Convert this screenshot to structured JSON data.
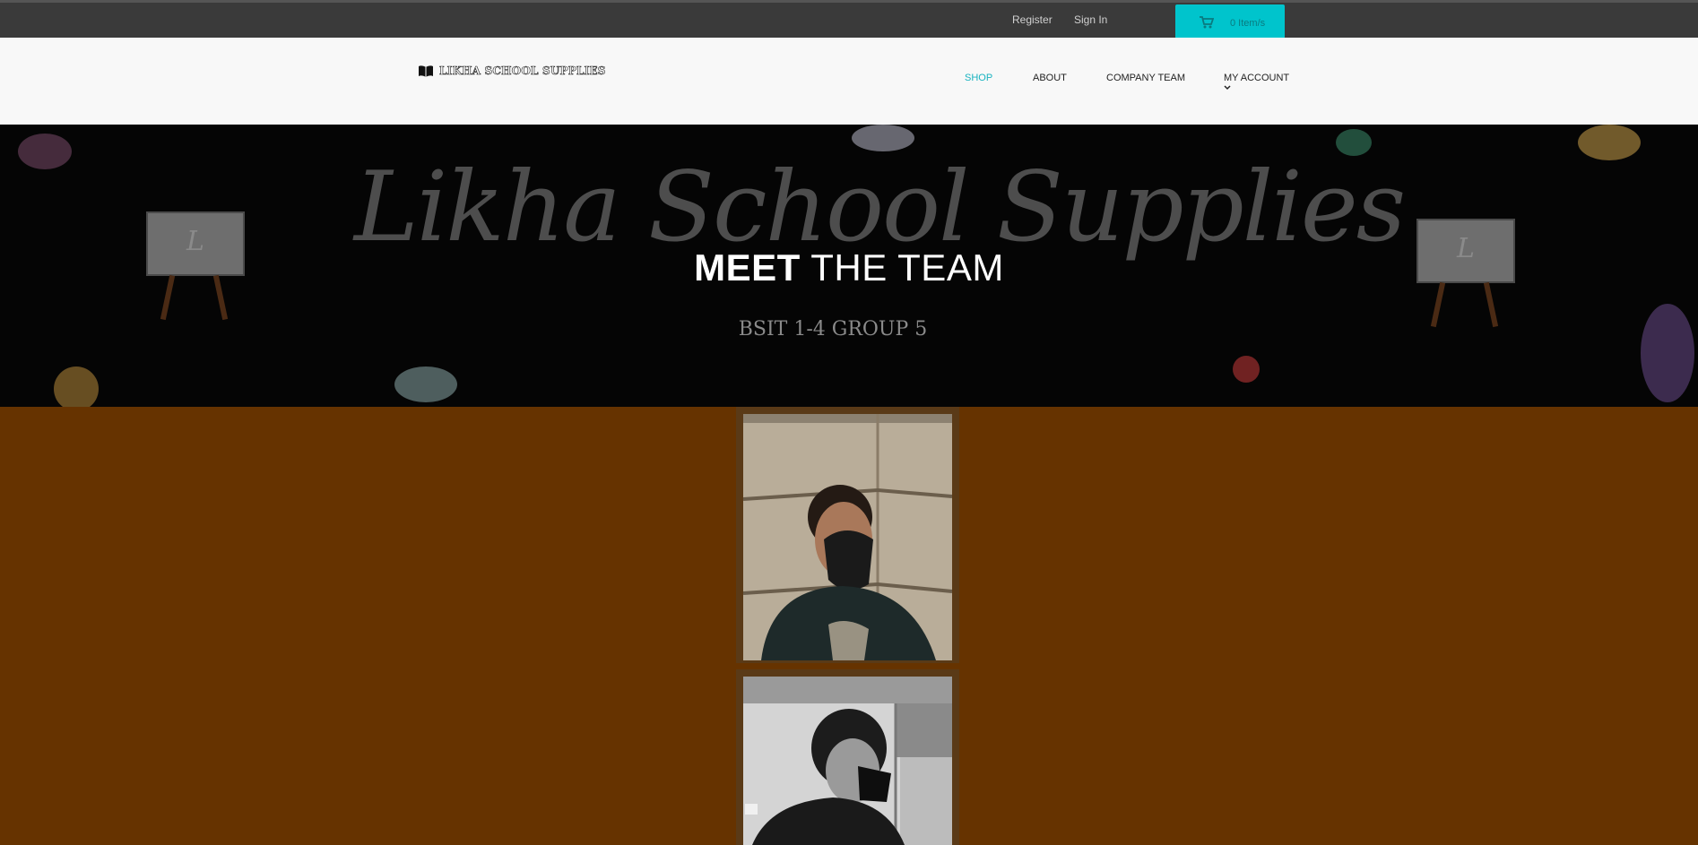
{
  "topbar": {
    "register": "Register",
    "signin": "Sign In",
    "cart_label": "0 Item/s",
    "cart_color": "#00c4cc"
  },
  "header": {
    "logo_text": "LIKHA SCHOOL SUPPLIES",
    "nav": {
      "shop": "SHOP",
      "about": "ABOUT",
      "team": "COMPANY TEAM",
      "account": "MY ACCOUNT"
    },
    "active_color": "#19b3c0"
  },
  "hero": {
    "bg_text": "Likha School Supplies",
    "title_bold": "MEET",
    "title_rest": " THE TEAM",
    "subtitle": "BSIT 1-4 GROUP 5"
  },
  "team": {
    "background_color": "#663300",
    "members": [
      {
        "photo": "person-wearing-black-mask-photo"
      },
      {
        "photo": "person-grayscale-side-profile-photo"
      }
    ]
  }
}
